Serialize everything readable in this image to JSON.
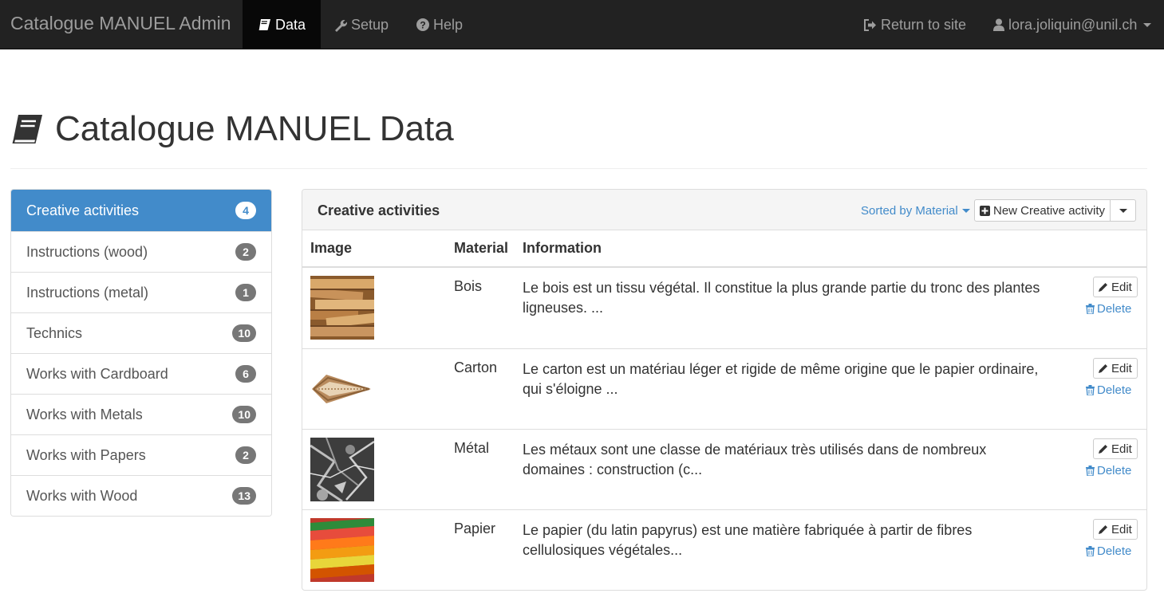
{
  "navbar": {
    "brand": "Catalogue MANUEL Admin",
    "items": [
      {
        "label": "Data",
        "icon": "book-icon",
        "active": true
      },
      {
        "label": "Setup",
        "icon": "wrench-icon",
        "active": false
      },
      {
        "label": "Help",
        "icon": "question-circle-icon",
        "active": false
      }
    ],
    "return_label": "Return to site",
    "user_label": "lora.joliquin@unil.ch"
  },
  "page": {
    "title": "Catalogue MANUEL Data"
  },
  "sidebar": {
    "items": [
      {
        "label": "Creative activities",
        "count": "4",
        "active": true
      },
      {
        "label": "Instructions (wood)",
        "count": "2"
      },
      {
        "label": "Instructions (metal)",
        "count": "1"
      },
      {
        "label": "Technics",
        "count": "10"
      },
      {
        "label": "Works with Cardboard",
        "count": "6"
      },
      {
        "label": "Works with Metals",
        "count": "10"
      },
      {
        "label": "Works with Papers",
        "count": "2"
      },
      {
        "label": "Works with Wood",
        "count": "13"
      }
    ]
  },
  "panel": {
    "title": "Creative activities",
    "sort_label": "Sorted by Material",
    "new_label": "New Creative activity",
    "columns": {
      "image": "Image",
      "material": "Material",
      "information": "Information"
    },
    "edit_label": "Edit",
    "delete_label": "Delete",
    "rows": [
      {
        "material": "Bois",
        "information": "Le bois est un tissu végétal. Il constitue la plus grande partie du tronc des plantes ligneuses. ...",
        "image": "wood-planks-image"
      },
      {
        "material": "Carton",
        "information": "Le carton est un matériau léger et rigide de même origine que le papier ordinaire, qui s'éloigne ...",
        "image": "cardboard-image"
      },
      {
        "material": "Métal",
        "information": "Les métaux sont une classe de matériaux très utilisés dans de nombreux domaines : construction (c...",
        "image": "metal-scrap-image"
      },
      {
        "material": "Papier",
        "information": "Le papier (du latin papyrus) est une matière fabriquée à partir de fibres cellulosiques végétales...",
        "image": "colored-paper-image"
      }
    ]
  },
  "colors": {
    "navbar_bg": "#222222",
    "navbar_active_bg": "#080808",
    "primary": "#428bca",
    "badge": "#777777"
  }
}
